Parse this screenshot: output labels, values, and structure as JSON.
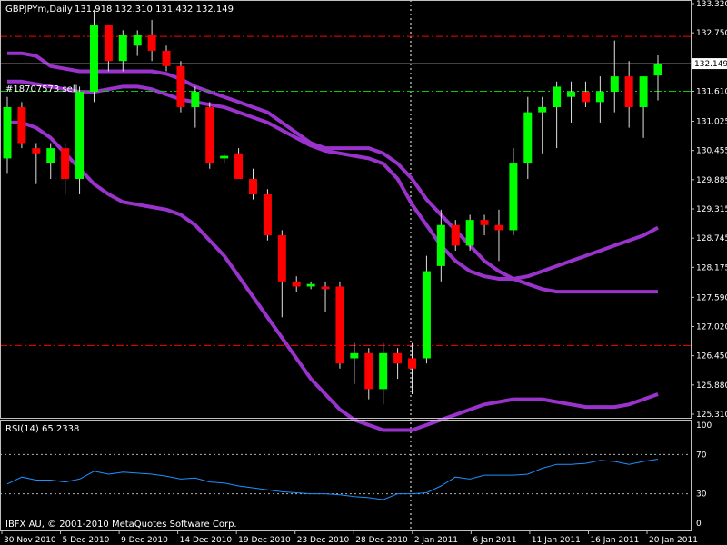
{
  "header": {
    "symbol": "GBPJPYm,Daily",
    "ohlc": "131.918 132.310 131.432 132.149"
  },
  "order_label": "#18707573 sell",
  "current_price_label": "132.149",
  "rsi_title": "RSI(14) 65.2338",
  "copyright": "IBFX AU, © 2001-2010 MetaQuotes Software Corp.",
  "colors": {
    "bull": "#00ff00",
    "bear": "#ff0000",
    "band": "#9933cc",
    "rsi": "#1e90ff",
    "level_red": "#ff0000",
    "level_green": "#00cc00",
    "axis": "#c0c0c0"
  },
  "chart_data": [
    {
      "type": "candlestick",
      "yticks": [
        125.31,
        125.88,
        126.45,
        127.02,
        127.59,
        128.175,
        128.745,
        129.315,
        129.885,
        130.455,
        131.025,
        131.61,
        132.18,
        132.75,
        133.32
      ],
      "ytick_labels": [
        "125.310",
        "125.880",
        "126.450",
        "127.020",
        "127.590",
        "128.175",
        "128.745",
        "129.315",
        "129.885",
        "130.455",
        "131.025",
        "131.610",
        "132.180",
        "132.750",
        "133.320"
      ],
      "ylim": [
        125.31,
        133.32
      ],
      "x_labels": [
        "30 Nov 2010",
        "5 Dec 2010",
        "9 Dec 2010",
        "14 Dec 2010",
        "19 Dec 2010",
        "23 Dec 2010",
        "28 Dec 2010",
        "2 Jan 2011",
        "6 Jan 2011",
        "11 Jan 2011",
        "16 Jan 2011",
        "20 Jan 2011"
      ],
      "candles": [
        {
          "o": 130.3,
          "h": 131.5,
          "l": 130.0,
          "c": 131.3
        },
        {
          "o": 131.3,
          "h": 131.4,
          "l": 130.5,
          "c": 130.6
        },
        {
          "o": 130.5,
          "h": 130.6,
          "l": 129.8,
          "c": 130.4
        },
        {
          "o": 130.2,
          "h": 130.6,
          "l": 129.9,
          "c": 130.5
        },
        {
          "o": 130.5,
          "h": 130.6,
          "l": 129.6,
          "c": 129.9
        },
        {
          "o": 129.9,
          "h": 131.7,
          "l": 129.6,
          "c": 131.6
        },
        {
          "o": 131.6,
          "h": 133.2,
          "l": 131.4,
          "c": 132.9
        },
        {
          "o": 132.9,
          "h": 132.9,
          "l": 132.0,
          "c": 132.2
        },
        {
          "o": 132.2,
          "h": 132.8,
          "l": 132.0,
          "c": 132.7
        },
        {
          "o": 132.5,
          "h": 132.8,
          "l": 132.3,
          "c": 132.7
        },
        {
          "o": 132.7,
          "h": 133.0,
          "l": 132.2,
          "c": 132.4
        },
        {
          "o": 132.4,
          "h": 132.5,
          "l": 132.0,
          "c": 132.1
        },
        {
          "o": 132.1,
          "h": 132.2,
          "l": 131.2,
          "c": 131.3
        },
        {
          "o": 131.3,
          "h": 131.7,
          "l": 130.9,
          "c": 131.6
        },
        {
          "o": 131.3,
          "h": 131.4,
          "l": 130.1,
          "c": 130.2
        },
        {
          "o": 130.3,
          "h": 130.4,
          "l": 130.2,
          "c": 130.35
        },
        {
          "o": 130.4,
          "h": 130.5,
          "l": 129.9,
          "c": 129.9
        },
        {
          "o": 129.9,
          "h": 130.1,
          "l": 129.5,
          "c": 129.6
        },
        {
          "o": 129.6,
          "h": 129.7,
          "l": 128.7,
          "c": 128.8
        },
        {
          "o": 128.8,
          "h": 128.9,
          "l": 127.2,
          "c": 127.9
        },
        {
          "o": 127.9,
          "h": 128.0,
          "l": 127.7,
          "c": 127.8
        },
        {
          "o": 127.8,
          "h": 127.9,
          "l": 127.75,
          "c": 127.85
        },
        {
          "o": 127.8,
          "h": 127.9,
          "l": 127.3,
          "c": 127.75
        },
        {
          "o": 127.8,
          "h": 127.9,
          "l": 126.2,
          "c": 126.3
        },
        {
          "o": 126.4,
          "h": 126.7,
          "l": 125.9,
          "c": 126.5
        },
        {
          "o": 126.5,
          "h": 126.6,
          "l": 125.6,
          "c": 125.8
        },
        {
          "o": 125.8,
          "h": 126.7,
          "l": 125.5,
          "c": 126.5
        },
        {
          "o": 126.5,
          "h": 126.6,
          "l": 126.0,
          "c": 126.3
        },
        {
          "o": 126.4,
          "h": 126.7,
          "l": 125.7,
          "c": 126.2
        },
        {
          "o": 126.4,
          "h": 128.4,
          "l": 126.3,
          "c": 128.1
        },
        {
          "o": 128.2,
          "h": 129.3,
          "l": 127.9,
          "c": 129.0
        },
        {
          "o": 129.0,
          "h": 129.1,
          "l": 128.5,
          "c": 128.6
        },
        {
          "o": 128.6,
          "h": 129.2,
          "l": 128.5,
          "c": 129.1
        },
        {
          "o": 129.1,
          "h": 129.2,
          "l": 128.8,
          "c": 129.0
        },
        {
          "o": 129.0,
          "h": 129.3,
          "l": 128.3,
          "c": 128.9
        },
        {
          "o": 128.9,
          "h": 130.5,
          "l": 128.8,
          "c": 130.2
        },
        {
          "o": 130.2,
          "h": 131.5,
          "l": 129.9,
          "c": 131.2
        },
        {
          "o": 131.2,
          "h": 131.5,
          "l": 130.4,
          "c": 131.3
        },
        {
          "o": 131.3,
          "h": 131.8,
          "l": 130.5,
          "c": 131.7
        },
        {
          "o": 131.5,
          "h": 131.8,
          "l": 131.0,
          "c": 131.6
        },
        {
          "o": 131.6,
          "h": 131.8,
          "l": 131.3,
          "c": 131.4
        },
        {
          "o": 131.4,
          "h": 131.9,
          "l": 131.0,
          "c": 131.6
        },
        {
          "o": 131.6,
          "h": 132.6,
          "l": 131.2,
          "c": 131.9
        },
        {
          "o": 131.9,
          "h": 132.2,
          "l": 130.9,
          "c": 131.3
        },
        {
          "o": 131.3,
          "h": 131.9,
          "l": 130.7,
          "c": 131.9
        },
        {
          "o": 131.918,
          "h": 132.31,
          "l": 131.432,
          "c": 132.149
        }
      ],
      "bands": {
        "upper": [
          132.35,
          132.35,
          132.3,
          132.1,
          132.05,
          132.0,
          132.0,
          132.0,
          132.0,
          132.0,
          132.0,
          131.95,
          131.85,
          131.7,
          131.6,
          131.5,
          131.4,
          131.3,
          131.2,
          131.0,
          130.8,
          130.6,
          130.5,
          130.5,
          130.5,
          130.5,
          130.4,
          130.2,
          129.9,
          129.5,
          129.2,
          128.9,
          128.6,
          128.3,
          128.1,
          127.95,
          127.85,
          127.75,
          127.7,
          127.7,
          127.7,
          127.7,
          127.7,
          127.7,
          127.7,
          127.7
        ],
        "middle": [
          131.8,
          131.8,
          131.75,
          131.7,
          131.65,
          131.6,
          131.6,
          131.65,
          131.7,
          131.7,
          131.65,
          131.55,
          131.45,
          131.4,
          131.35,
          131.3,
          131.2,
          131.1,
          131.0,
          130.85,
          130.7,
          130.55,
          130.45,
          130.4,
          130.35,
          130.3,
          130.2,
          129.9,
          129.4,
          129.0,
          128.6,
          128.3,
          128.1,
          128.0,
          127.95,
          127.95,
          128.0,
          128.1,
          128.2,
          128.3,
          128.4,
          128.5,
          128.6,
          128.7,
          128.8,
          128.95
        ],
        "lower": [
          131.0,
          131.0,
          130.9,
          130.7,
          130.4,
          130.1,
          129.8,
          129.6,
          129.45,
          129.4,
          129.35,
          129.3,
          129.2,
          129.0,
          128.7,
          128.4,
          128.0,
          127.6,
          127.2,
          126.8,
          126.4,
          126.0,
          125.7,
          125.4,
          125.2,
          125.1,
          125.0,
          125.0,
          125.0,
          125.1,
          125.2,
          125.3,
          125.4,
          125.5,
          125.55,
          125.6,
          125.6,
          125.6,
          125.55,
          125.5,
          125.45,
          125.45,
          125.45,
          125.5,
          125.6,
          125.7
        ]
      },
      "levels": [
        {
          "value": 132.68,
          "style": "red-dashdot"
        },
        {
          "value": 131.61,
          "style": "green-dashdot"
        },
        {
          "value": 126.65,
          "style": "red-dashdot"
        },
        {
          "value": 132.149,
          "style": "current-solid"
        }
      ]
    },
    {
      "type": "line",
      "title": "RSI(14) 65.2338",
      "yticks": [
        0,
        30,
        70,
        100
      ],
      "ylim": [
        0,
        100
      ],
      "levels": [
        30,
        70
      ],
      "values": [
        40,
        47,
        44,
        44,
        42,
        45,
        53,
        50,
        52,
        51,
        50,
        48,
        45,
        46,
        42,
        41,
        38,
        36,
        34,
        32,
        31,
        30,
        30,
        29,
        27,
        26,
        24,
        30,
        30,
        31,
        38,
        47,
        45,
        49,
        49,
        49,
        50,
        56,
        60,
        60,
        61,
        64,
        63,
        60,
        63,
        65.2338
      ]
    }
  ]
}
